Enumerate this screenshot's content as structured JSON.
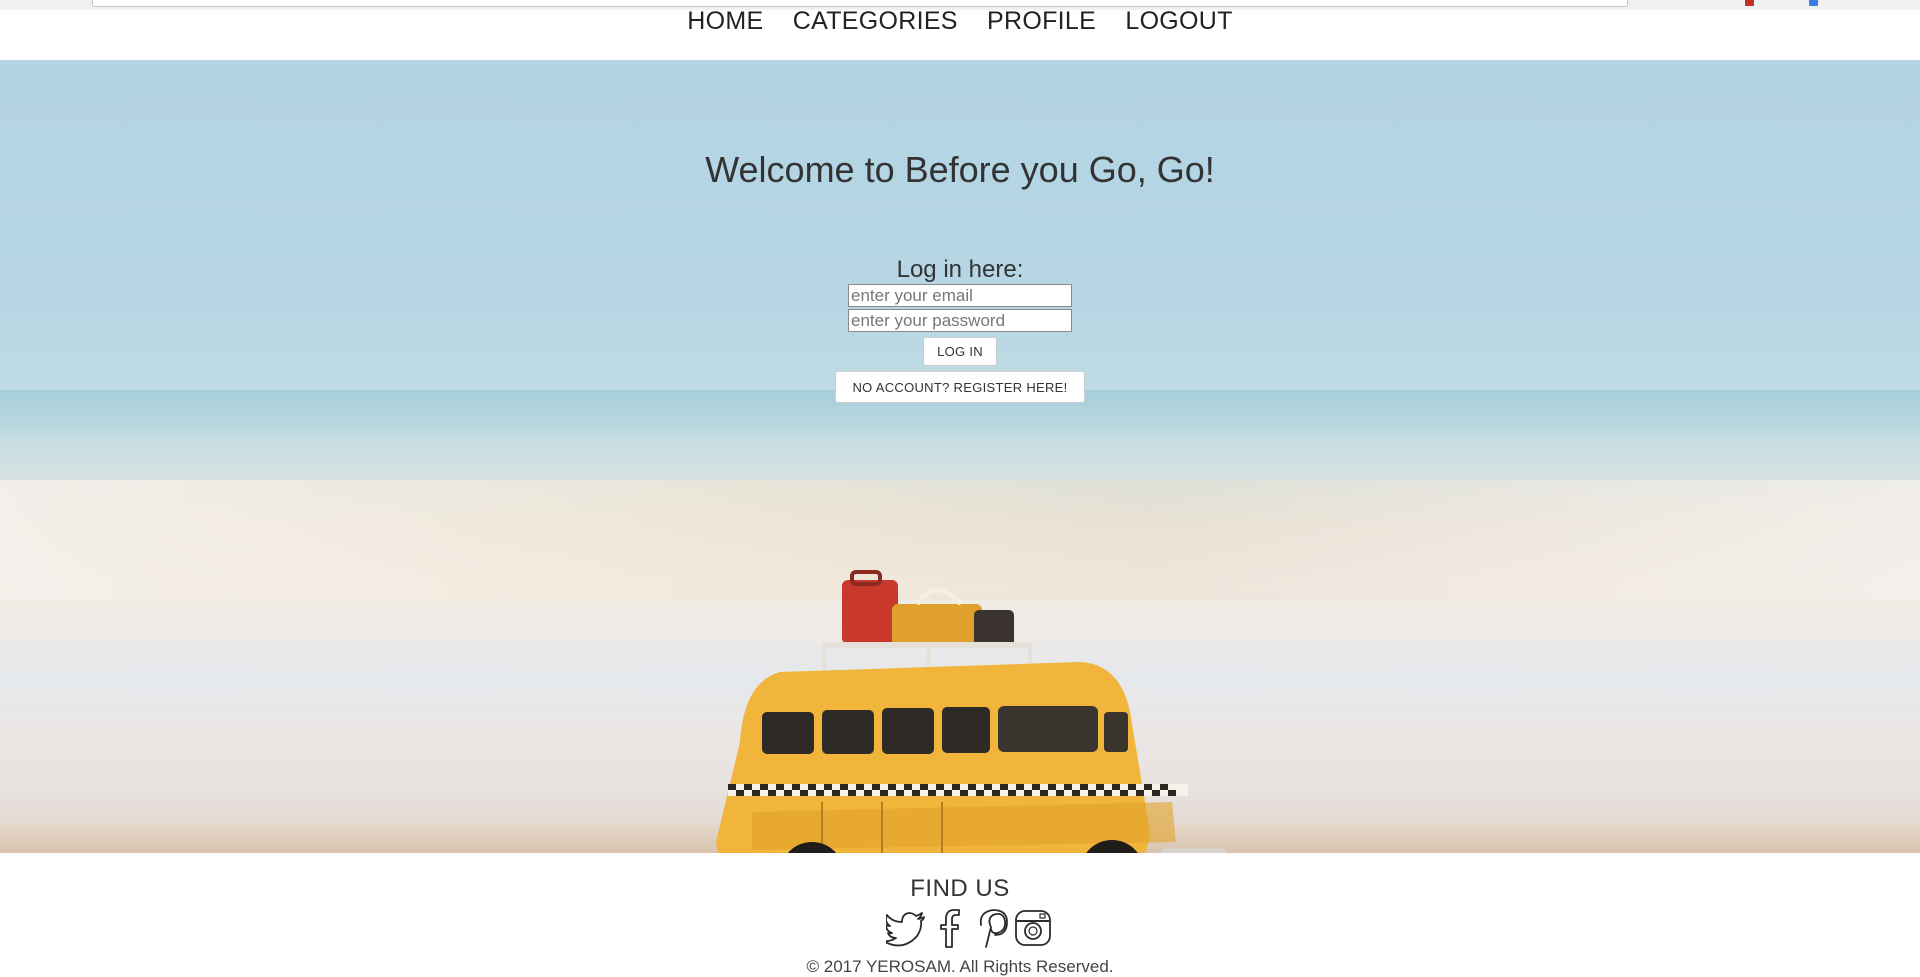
{
  "nav": {
    "items": [
      {
        "label": "HOME"
      },
      {
        "label": "CATEGORIES"
      },
      {
        "label": "PROFILE"
      },
      {
        "label": "LOGOUT"
      }
    ]
  },
  "hero": {
    "title": "Welcome to Before you Go, Go!",
    "login": {
      "label": "Log in here:",
      "email_placeholder": "enter your email",
      "password_placeholder": "enter your password",
      "login_button": "LOG IN",
      "register_button": "NO ACCOUNT? REGISTER HERE!"
    },
    "background_image": "toy-bus-beach"
  },
  "footer": {
    "find_us": "FIND US",
    "social_icons": [
      "twitter-icon",
      "facebook-icon",
      "pinterest-icon",
      "instagram-icon"
    ],
    "copyright": "© 2017 YEROSAM. All Rights Reserved."
  },
  "colors": {
    "text": "#333333",
    "sky": "#b3d4e4",
    "bus_yellow": "#f0b53a"
  }
}
